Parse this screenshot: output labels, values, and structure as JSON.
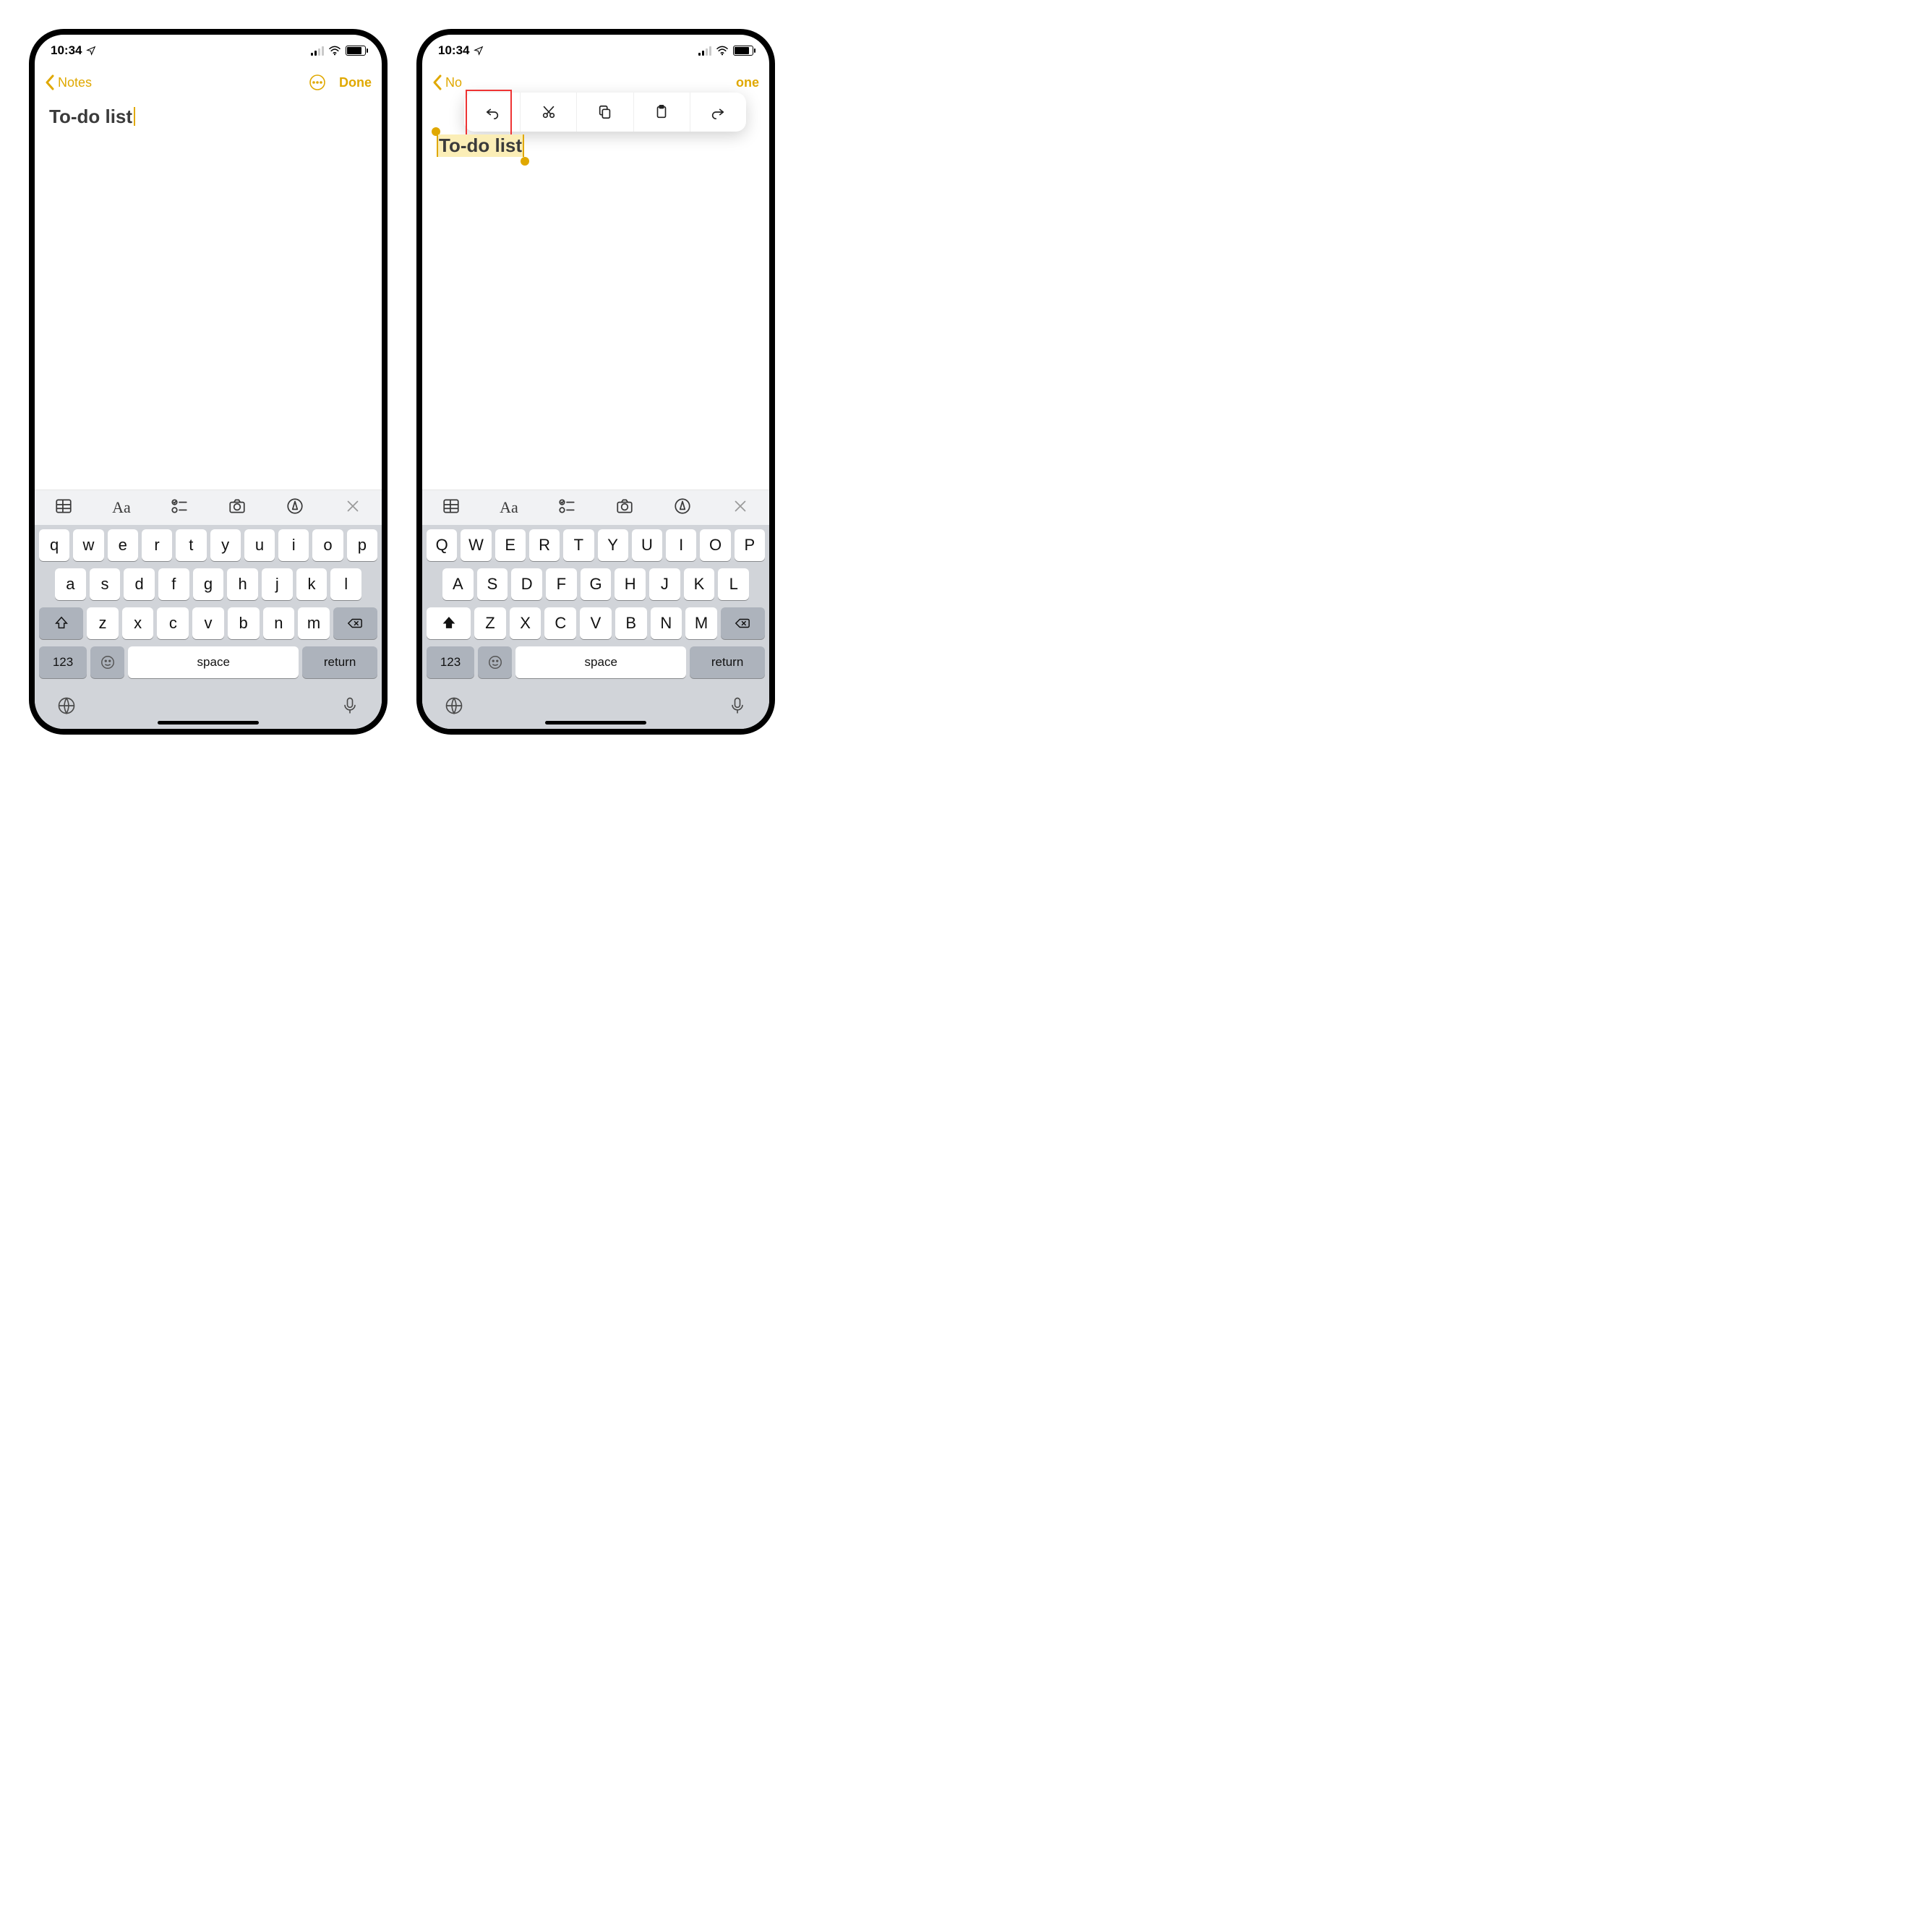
{
  "status": {
    "time": "10:34"
  },
  "nav": {
    "back": "Notes",
    "done": "Done",
    "one": "one",
    "no": "No"
  },
  "note": {
    "title": "To-do list"
  },
  "keyboardLower": {
    "r1": [
      "q",
      "w",
      "e",
      "r",
      "t",
      "y",
      "u",
      "i",
      "o",
      "p"
    ],
    "r2": [
      "a",
      "s",
      "d",
      "f",
      "g",
      "h",
      "j",
      "k",
      "l"
    ],
    "r3": [
      "z",
      "x",
      "c",
      "v",
      "b",
      "n",
      "m"
    ]
  },
  "keyboardUpper": {
    "r1": [
      "Q",
      "W",
      "E",
      "R",
      "T",
      "Y",
      "U",
      "I",
      "O",
      "P"
    ],
    "r2": [
      "A",
      "S",
      "D",
      "F",
      "G",
      "H",
      "J",
      "K",
      "L"
    ],
    "r3": [
      "Z",
      "X",
      "C",
      "V",
      "B",
      "N",
      "M"
    ]
  },
  "kbLabels": {
    "num": "123",
    "space": "space",
    "return": "return"
  }
}
